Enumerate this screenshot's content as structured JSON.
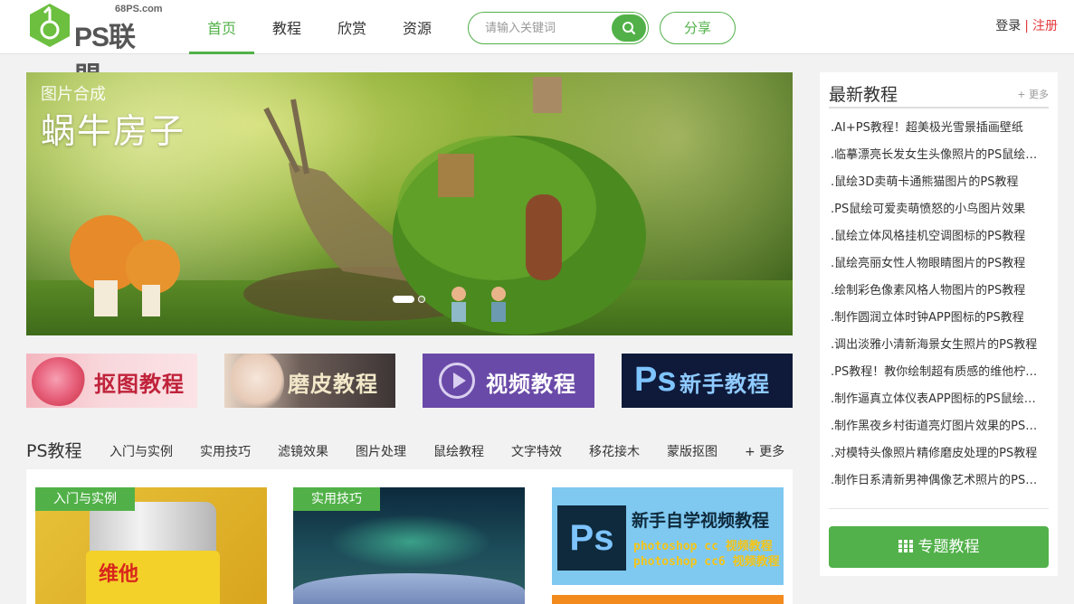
{
  "header": {
    "logo_site": "68PS.com",
    "logo_text": "PS联盟",
    "nav": [
      {
        "label": "首页",
        "active": true
      },
      {
        "label": "教程",
        "active": false
      },
      {
        "label": "欣赏",
        "active": false
      },
      {
        "label": "资源",
        "active": false
      }
    ],
    "search": {
      "placeholder": "请输入关键词",
      "icon": "search-icon"
    },
    "share_label": "分享",
    "login_label": "登录",
    "separator": "|",
    "register_label": "注册"
  },
  "banner": {
    "category": "图片合成",
    "title": "蜗牛房子",
    "slides": 2,
    "active_slide": 1
  },
  "tiles": [
    {
      "label": "抠图教程"
    },
    {
      "label": "磨皮教程"
    },
    {
      "label": "视频教程"
    },
    {
      "label": "新手教程",
      "mark": "Ps"
    }
  ],
  "ps_section": {
    "title": "PS教程",
    "tabs": [
      "入门与实例",
      "实用技巧",
      "滤镜效果",
      "图片处理",
      "鼠绘教程",
      "文字特效",
      "移花接木",
      "蒙版抠图",
      "+ 更多"
    ],
    "cards": [
      {
        "tag": "入门与实例",
        "can_logo": "维他"
      },
      {
        "tag": "实用技巧"
      },
      {
        "mark": "Ps",
        "line1": "新手自学视频教程",
        "line2": "photoshop cc 视频教程",
        "line3": "photoshop cc6 视频教程"
      }
    ]
  },
  "sidebar": {
    "title": "最新教程",
    "more_label": "+ 更多",
    "items": [
      ".AI+PS教程！超美极光雪景插画壁纸",
      ".临摹漂亮长发女生头像照片的PS鼠绘教程",
      ".鼠绘3D卖萌卡通熊猫图片的PS教程",
      ".PS鼠绘可爱卖萌愤怒的小鸟图片效果",
      ".鼠绘立体风格挂机空调图标的PS教程",
      ".鼠绘亮丽女性人物眼睛图片的PS教程",
      ".绘制彩色像素风格人物图片的PS教程",
      ".制作圆润立体时钟APP图标的PS教程",
      ".调出淡雅小清新海景女生照片的PS教程",
      ".PS教程！教你绘制超有质感的维他柠檬茶",
      ".制作逼真立体仪表APP图标的PS鼠绘教程",
      ".制作黑夜乡村街道亮灯图片效果的PS教程",
      ".对模特头像照片精修磨皮处理的PS教程",
      ".制作日系清新男神偶像艺术照片的PS教程"
    ],
    "topic_button": "专题教程"
  },
  "colors": {
    "accent": "#51b148",
    "register": "#e4393c"
  }
}
